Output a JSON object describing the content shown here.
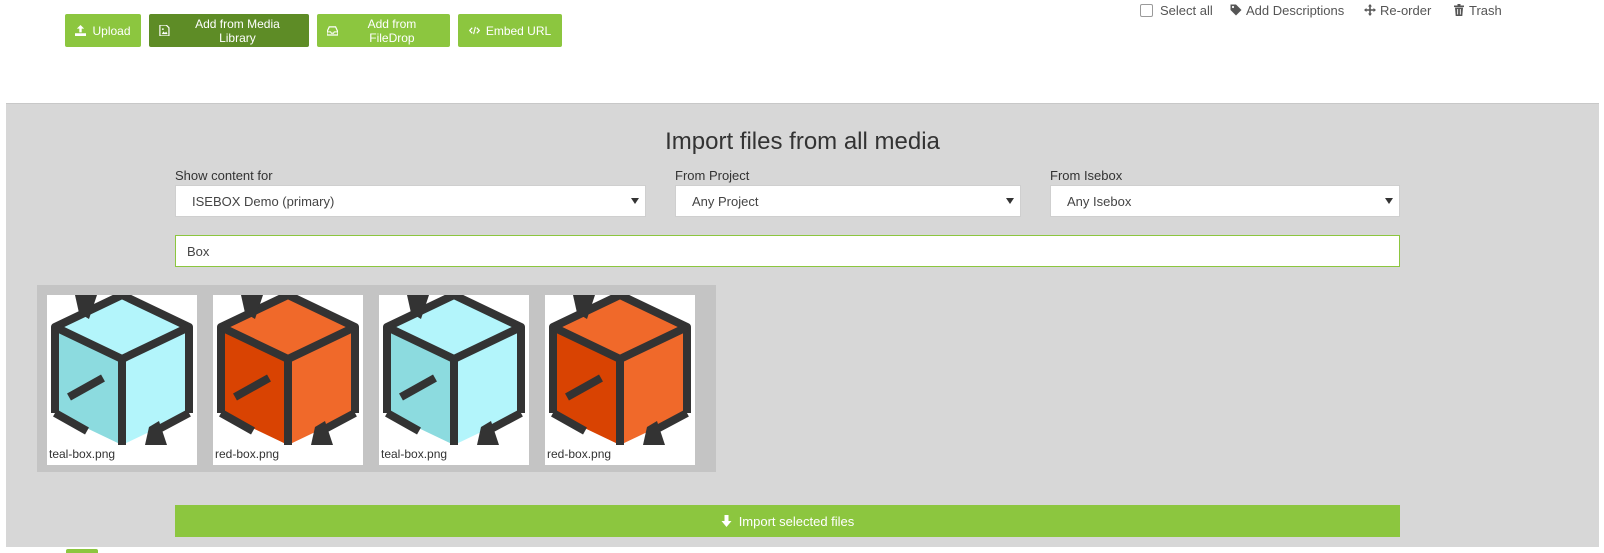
{
  "toolbar": {
    "buttons": [
      {
        "label": "Upload",
        "icon": "upload-icon"
      },
      {
        "label": "Add from Media Library",
        "icon": "media-library-icon",
        "active": true
      },
      {
        "label": "Add from FileDrop",
        "icon": "filedrop-icon"
      },
      {
        "label": "Embed URL",
        "icon": "code-icon"
      }
    ],
    "actions": [
      {
        "label": "Select all",
        "icon": "checkbox"
      },
      {
        "label": "Add Descriptions",
        "icon": "tag-icon"
      },
      {
        "label": "Re-order",
        "icon": "move-icon"
      },
      {
        "label": "Trash",
        "icon": "trash-icon"
      }
    ]
  },
  "import_panel": {
    "title": "Import files from all media",
    "filters": [
      {
        "label": "Show content for",
        "value": "ISEBOX Demo (primary)"
      },
      {
        "label": "From Project",
        "value": "Any Project"
      },
      {
        "label": "From Isebox",
        "value": "Any Isebox"
      }
    ],
    "search": {
      "value": "Box"
    },
    "files": [
      {
        "name": "teal-box.png",
        "color": "teal"
      },
      {
        "name": "red-box.png",
        "color": "red"
      },
      {
        "name": "teal-box.png",
        "color": "teal"
      },
      {
        "name": "red-box.png",
        "color": "red"
      }
    ],
    "import_button": {
      "label": "Import selected files",
      "icon": "arrow-down-icon"
    }
  },
  "colors": {
    "accent_green": "#8cc63f",
    "accent_green_active": "#5e8c26",
    "panel_bg": "#d7d7d7",
    "teal_light": "#b3f5fb",
    "teal_dark": "#8cdbdf",
    "red_light": "#f0692a",
    "red_dark": "#d94302",
    "outline": "#333333"
  }
}
